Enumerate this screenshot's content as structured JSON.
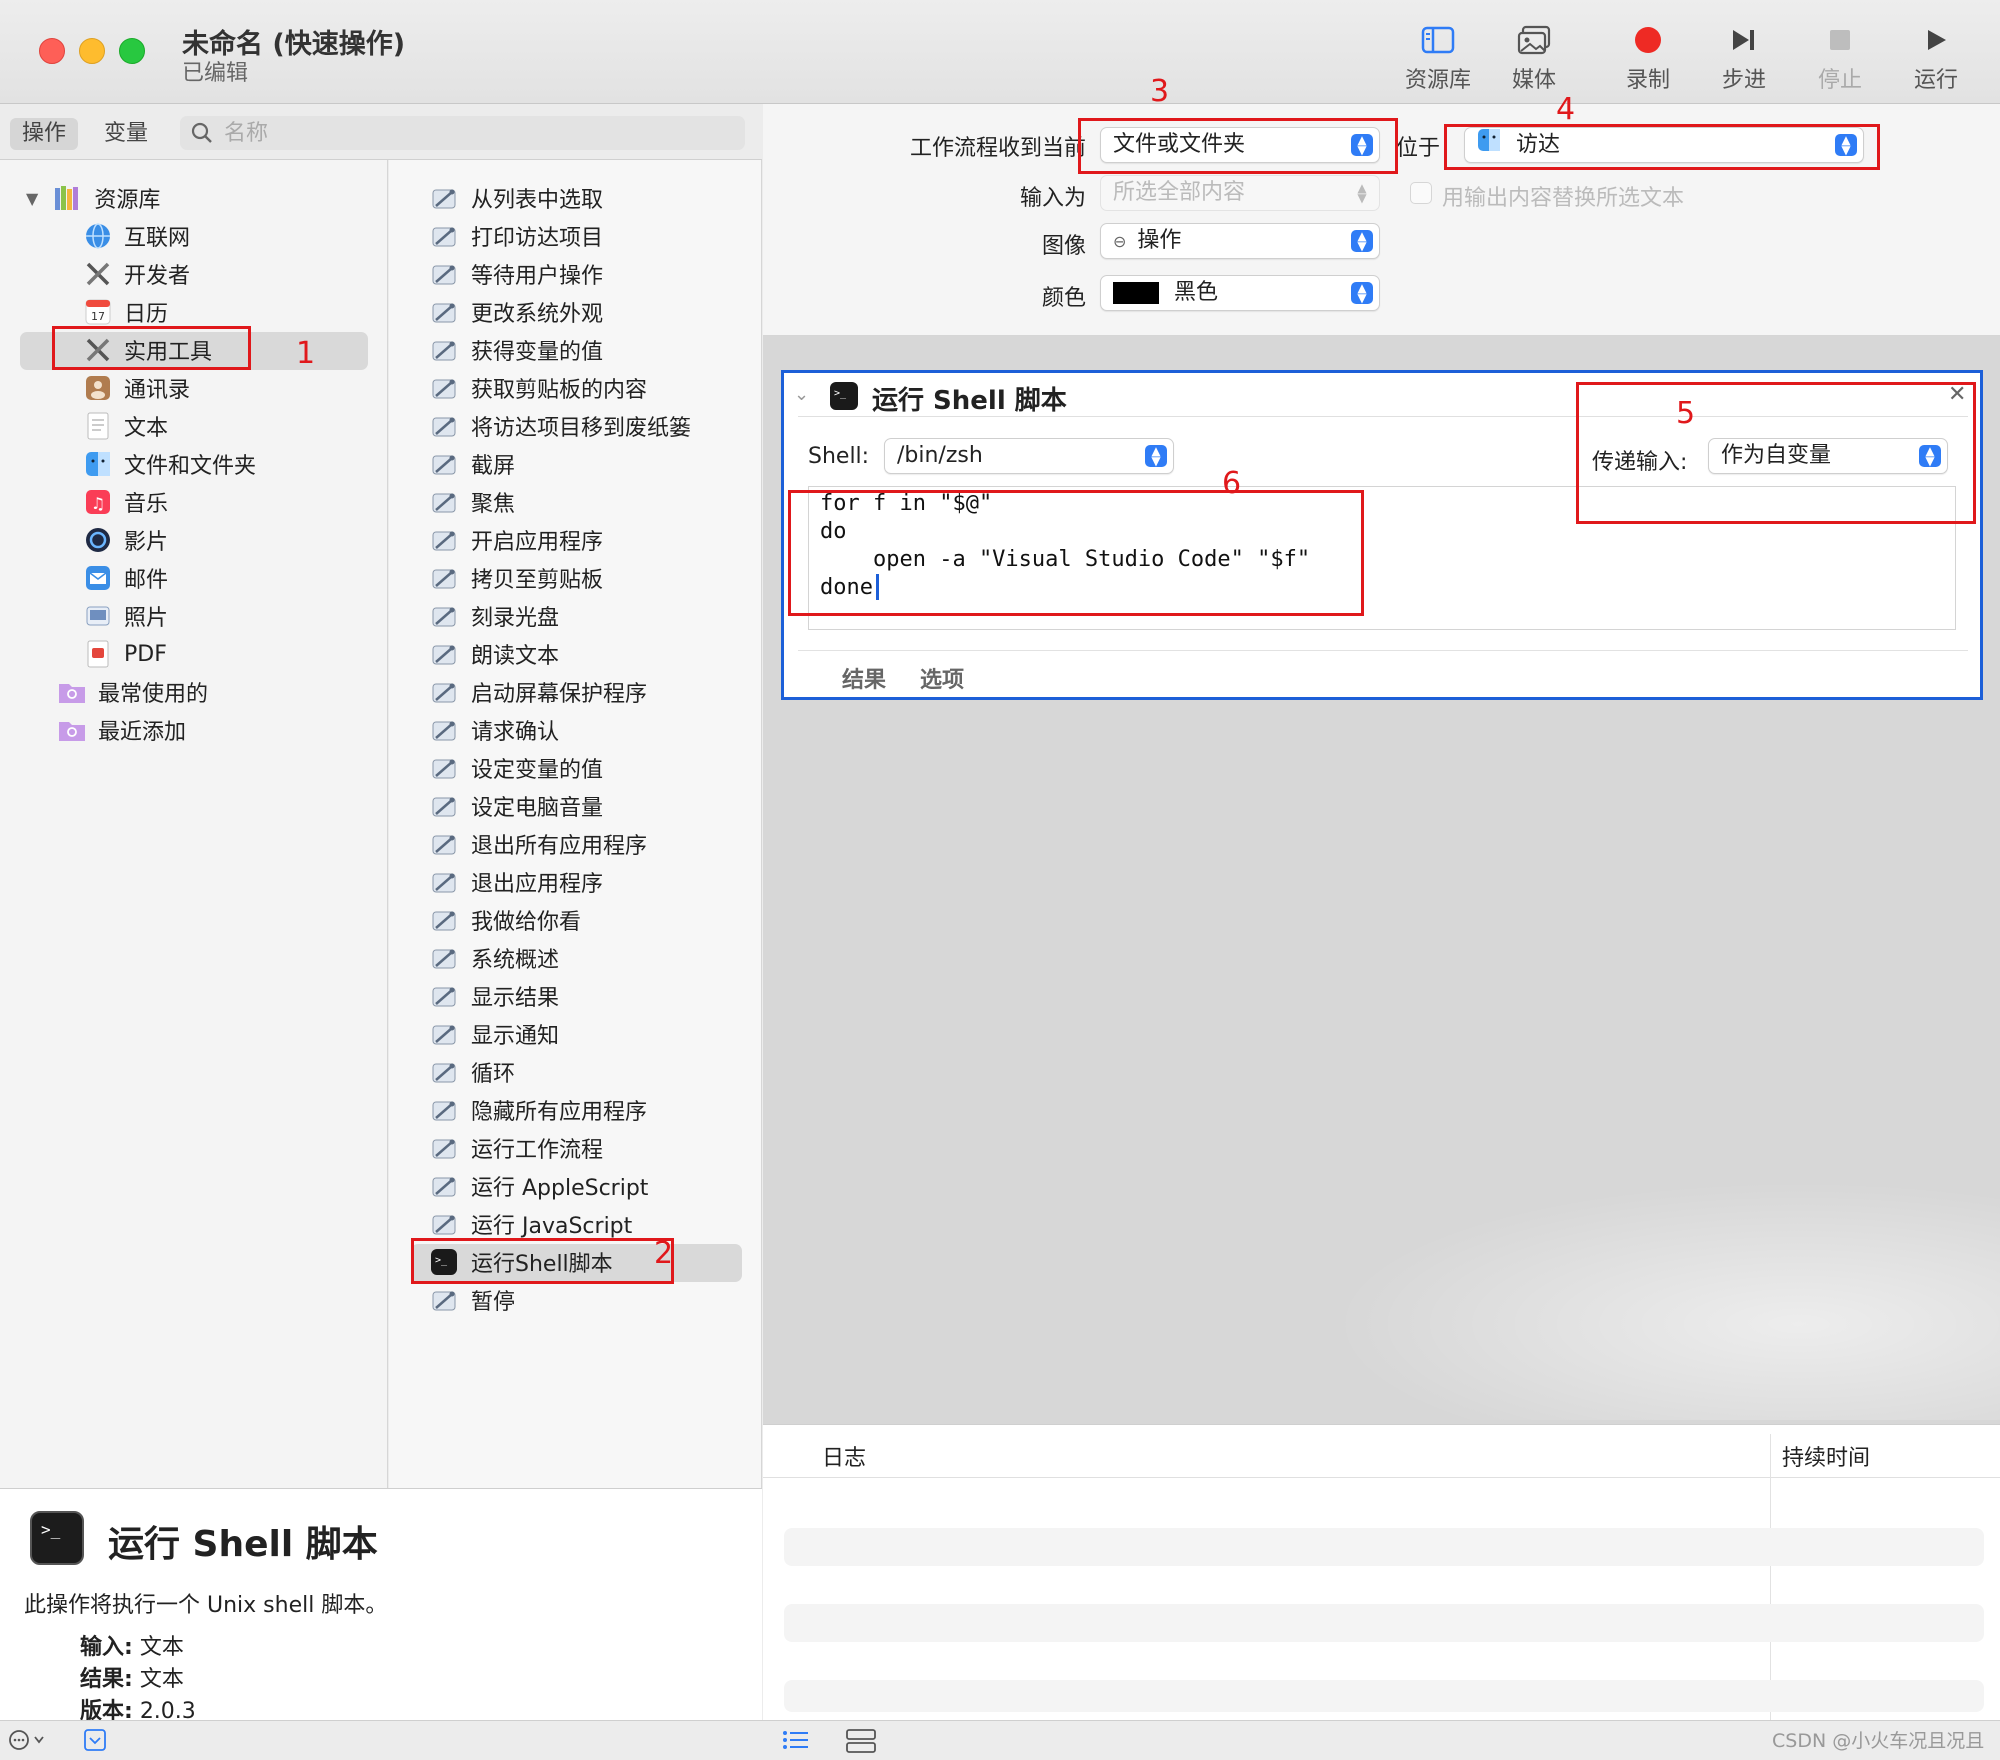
{
  "window": {
    "title": "未命名 (快速操作)",
    "subtitle": "已编辑"
  },
  "toolbar": {
    "library": "资源库",
    "media": "媒体",
    "record": "录制",
    "step": "步进",
    "stop": "停止",
    "run": "运行"
  },
  "left_tabs": {
    "actions": "操作",
    "variables": "变量",
    "search_placeholder": "名称"
  },
  "library": {
    "root": "资源库",
    "items": [
      {
        "label": "互联网",
        "icon": "globe-icon"
      },
      {
        "label": "开发者",
        "icon": "tools-icon"
      },
      {
        "label": "日历",
        "icon": "calendar-icon"
      },
      {
        "label": "实用工具",
        "icon": "tools-icon"
      },
      {
        "label": "通讯录",
        "icon": "contacts-icon"
      },
      {
        "label": "文本",
        "icon": "text-icon"
      },
      {
        "label": "文件和文件夹",
        "icon": "finder-icon"
      },
      {
        "label": "音乐",
        "icon": "music-icon"
      },
      {
        "label": "影片",
        "icon": "movie-icon"
      },
      {
        "label": "邮件",
        "icon": "mail-icon"
      },
      {
        "label": "照片",
        "icon": "photos-icon"
      },
      {
        "label": "PDF",
        "icon": "pdf-icon"
      }
    ],
    "smart_groups": [
      "最常使用的",
      "最近添加"
    ]
  },
  "actions": [
    "从列表中选取",
    "打印访达项目",
    "等待用户操作",
    "更改系统外观",
    "获得变量的值",
    "获取剪贴板的内容",
    "将访达项目移到废纸篓",
    "截屏",
    "聚焦",
    "开启应用程序",
    "拷贝至剪贴板",
    "刻录光盘",
    "朗读文本",
    "启动屏幕保护程序",
    "请求确认",
    "设定变量的值",
    "设定电脑音量",
    "退出所有应用程序",
    "退出应用程序",
    "我做给你看",
    "系统概述",
    "显示结果",
    "显示通知",
    "循环",
    "隐藏所有应用程序",
    "运行工作流程",
    "运行 AppleScript",
    "运行 JavaScript",
    "运行Shell脚本",
    "暂停"
  ],
  "description": {
    "title": "运行 Shell 脚本",
    "text": "此操作将执行一个 Unix shell 脚本。",
    "input_label": "输入:",
    "input_value": "文本",
    "result_label": "结果:",
    "result_value": "文本",
    "version_label": "版本:",
    "version_value": "2.0.3"
  },
  "config": {
    "receives_label": "工作流程收到当前",
    "receives_value": "文件或文件夹",
    "in_label": "位于",
    "in_value": "访达",
    "input_is_label": "输入为",
    "input_is_value": "所选全部内容",
    "replace_label": "用输出内容替换所选文本",
    "image_label": "图像",
    "image_value": "操作",
    "color_label": "颜色",
    "color_value": "黑色"
  },
  "card": {
    "title": "运行 Shell 脚本",
    "shell_label": "Shell:",
    "shell_value": "/bin/zsh",
    "pass_input_label": "传递输入:",
    "pass_input_value": "作为自变量",
    "code": "for f in \"$@\"\ndo\n    open -a \"Visual Studio Code\" \"$f\"\ndone",
    "tab_results": "结果",
    "tab_options": "选项"
  },
  "log": {
    "col_log": "日志",
    "col_duration": "持续时间"
  },
  "annotations": [
    "1",
    "2",
    "3",
    "4",
    "5",
    "6"
  ],
  "watermark": "CSDN @小火车况且况且",
  "colors": {
    "annotation_red": "#e0181b",
    "card_border": "#1c5fd8",
    "accent_blue": "#2f7cf6",
    "record_red": "#ee2a24"
  }
}
